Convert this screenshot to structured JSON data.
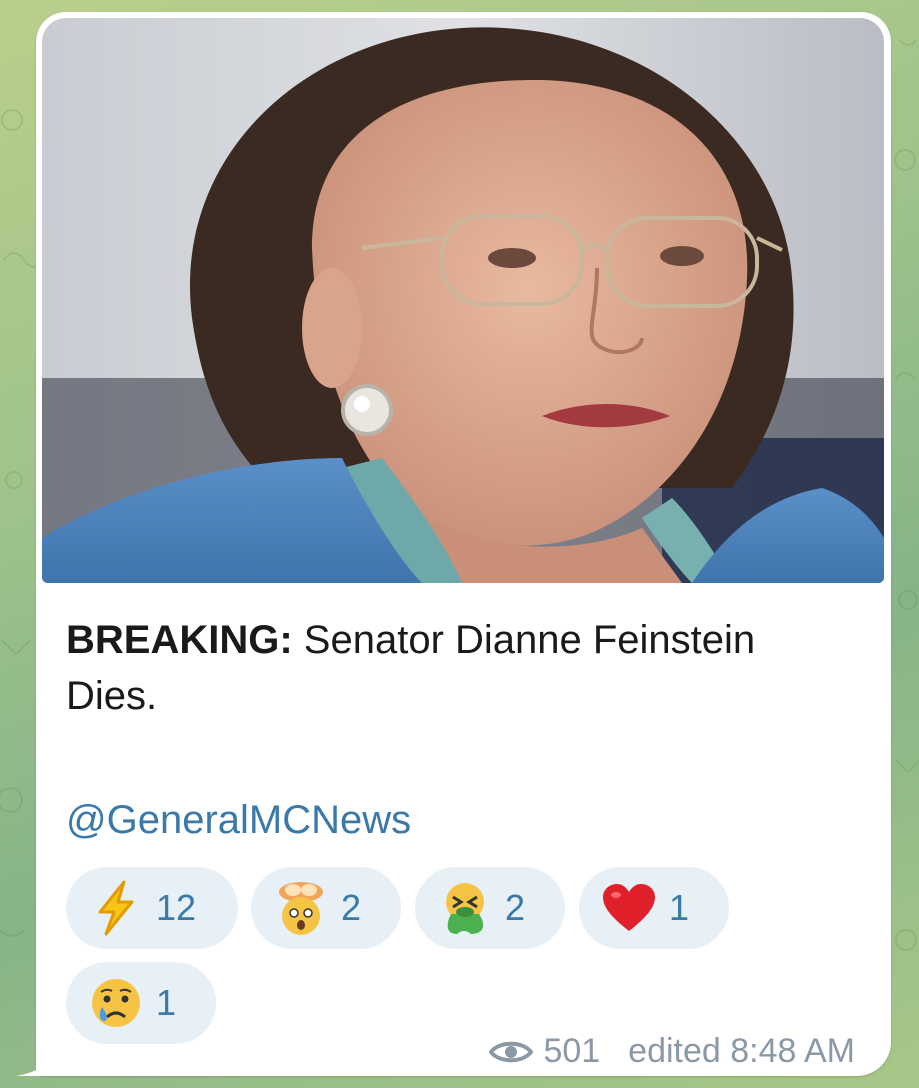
{
  "message": {
    "photo_alt_icon": "portrait-photo",
    "caption_bold": "BREAKING:",
    "caption_rest": " Senator Dianne Feinstein Dies.",
    "mention": "@GeneralMCNews"
  },
  "reactions": [
    {
      "emoji": "zap-icon",
      "count": "12"
    },
    {
      "emoji": "exploding-head-icon",
      "count": "2"
    },
    {
      "emoji": "vomiting-face-icon",
      "count": "2"
    },
    {
      "emoji": "red-heart-icon",
      "count": "1"
    },
    {
      "emoji": "crying-face-icon",
      "count": "1"
    }
  ],
  "meta": {
    "views": "501",
    "edited_time": "edited 8:48 AM"
  },
  "colors": {
    "link": "#3a79a8",
    "reaction_bg": "#e6f0f6",
    "meta": "#8b98a6"
  }
}
